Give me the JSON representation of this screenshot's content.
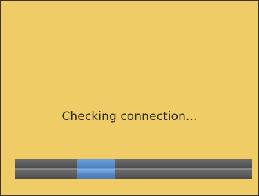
{
  "status": {
    "message": "Checking connection..."
  },
  "progress": {
    "type": "indeterminate",
    "segment_start_fraction": 0.26,
    "segment_end_fraction": 0.42,
    "track_color": "#5a5a5a",
    "segment_color": "#5b8fcc"
  },
  "colors": {
    "background": "#efcc66",
    "text": "#2b2718"
  }
}
